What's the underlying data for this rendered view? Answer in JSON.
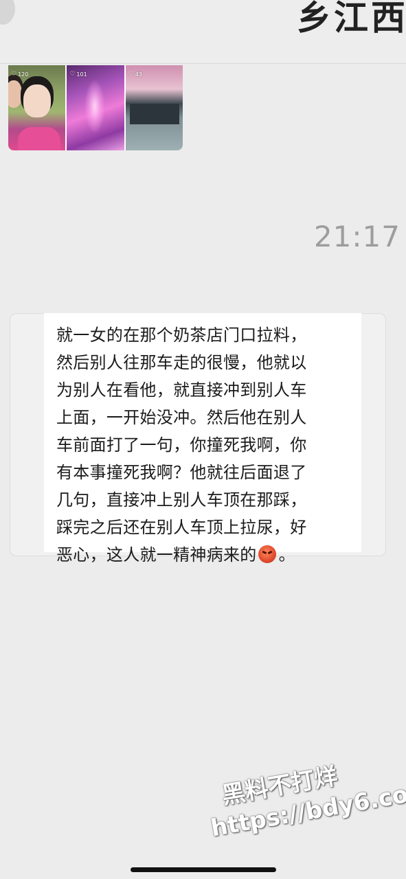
{
  "header": {
    "title": "乡江西"
  },
  "moments_preview": {
    "thumbnails": [
      {
        "likes": "120"
      },
      {
        "likes": "101"
      },
      {
        "likes": "43"
      }
    ]
  },
  "chat": {
    "timestamp": "21:17",
    "message_lines": [
      "就一女的在那个奶茶店门口拉料，",
      "然后别人往那车走的很慢，他就以",
      "为别人在看他，就直接冲到别人车",
      "上面，一开始没冲。然后他在别人",
      "车前面打了一句，你撞死我啊，你",
      "有本事撞死我啊？他就往后面退了",
      "几句，直接冲上别人车顶在那踩，",
      "踩完之后还在别人车顶上拉尿，好"
    ],
    "last_line_before_emoji": "恶心，这人就一精神病来的",
    "last_line_after_emoji": "。",
    "emoji_name": "angry-face-icon"
  },
  "watermark": {
    "line1": "黑料不打烊",
    "line2": "https://bdy6.co"
  },
  "colors": {
    "background": "#ececec",
    "bubble": "#ffffff",
    "timestamp": "#9d9d9d"
  }
}
